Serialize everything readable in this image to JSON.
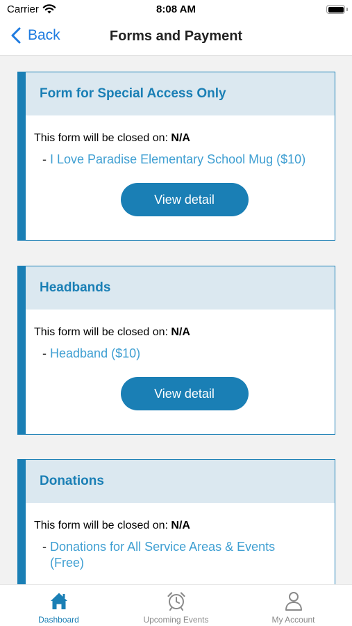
{
  "status_bar": {
    "carrier": "Carrier",
    "time": "8:08 AM"
  },
  "nav": {
    "back_label": "Back",
    "title": "Forms and Payment"
  },
  "forms": [
    {
      "title": "Form for Special Access Only",
      "closed_prefix": "This form will be closed on:",
      "closed_value": "N/A",
      "items": [
        "I Love Paradise Elementary School Mug ($10)"
      ],
      "button_label": "View detail"
    },
    {
      "title": "Headbands",
      "closed_prefix": "This form will be closed on:",
      "closed_value": "N/A",
      "items": [
        "Headband ($10)"
      ],
      "button_label": "View detail"
    },
    {
      "title": "Donations",
      "closed_prefix": "This form will be closed on:",
      "closed_value": "N/A",
      "items": [
        "Donations for All Service Areas & Events (Free)"
      ]
    }
  ],
  "tabs": [
    {
      "label": "Dashboard",
      "icon": "home-icon",
      "active": true
    },
    {
      "label": "Upcoming Events",
      "icon": "alarm-clock-icon",
      "active": false
    },
    {
      "label": "My Account",
      "icon": "person-icon",
      "active": false
    }
  ],
  "colors": {
    "accent": "#1a7fb5",
    "link": "#3f9fd2",
    "header_bg": "#dbe8f0",
    "page_bg": "#f2f2f2",
    "ios_blue": "#1e7be0"
  }
}
